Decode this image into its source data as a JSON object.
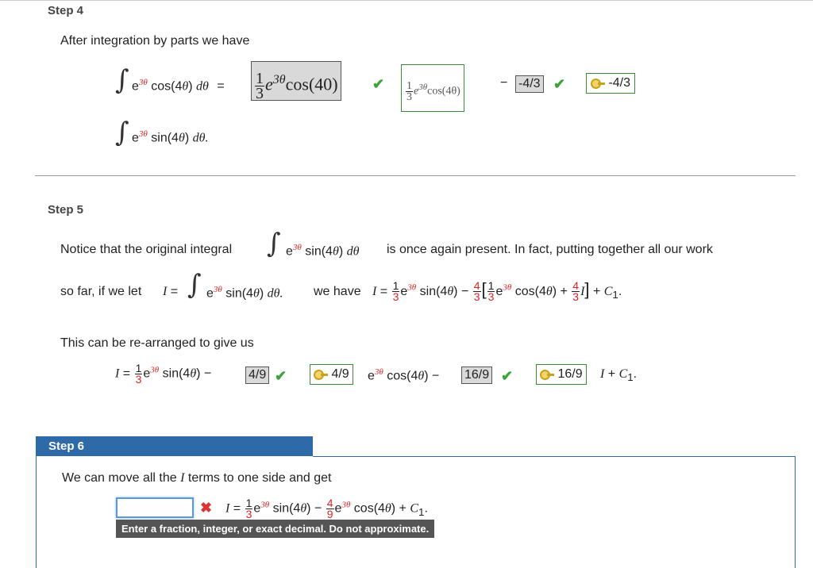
{
  "step4": {
    "label": "Step 4",
    "intro": "After integration by parts we have",
    "line1": {
      "integrand_e": "e",
      "exp": "3θ",
      "cos": "cos(4",
      "theta": "θ",
      "close": ")",
      "d": "dθ",
      "equals": "=",
      "gray_answer": {
        "num": "1",
        "den": "3",
        "e": "e",
        "exp": "3θ",
        "rest": "cos(40)"
      },
      "green_answer": {
        "num": "1",
        "den": "3",
        "e": "e",
        "exp": "3θ",
        "rest": "cos(4θ)"
      },
      "minus": "−",
      "gray_coef": "-4/3",
      "green_coef": "-4/3"
    },
    "line2": {
      "e": "e",
      "exp": "3θ",
      "sin": "sin(4",
      "theta": "θ",
      "close": ")",
      "d": "dθ."
    }
  },
  "step5": {
    "label": "Step 5",
    "text1a": "Notice that the original integral",
    "text1b": "is once again present. In fact, putting together all our work",
    "text2a": "so far, if we let",
    "I": "I",
    "eq": "=",
    "we_have": "we have",
    "C1": "C",
    "sub1": "1",
    "text3": "This can be re-arranged to give us",
    "gray1": "4/9",
    "green1": "4/9",
    "gray2": "16/9",
    "green2": "16/9"
  },
  "step6": {
    "label": "Step 6",
    "text": "We can move all the",
    "text_b": "terms to one side and get",
    "input_value": "",
    "tooltip": "Enter a fraction, integer, or exact decimal. Do not approximate."
  },
  "colors": {
    "accent_blue": "#2f6aa8",
    "correct_green": "#3da33d",
    "error_red": "#d33"
  }
}
